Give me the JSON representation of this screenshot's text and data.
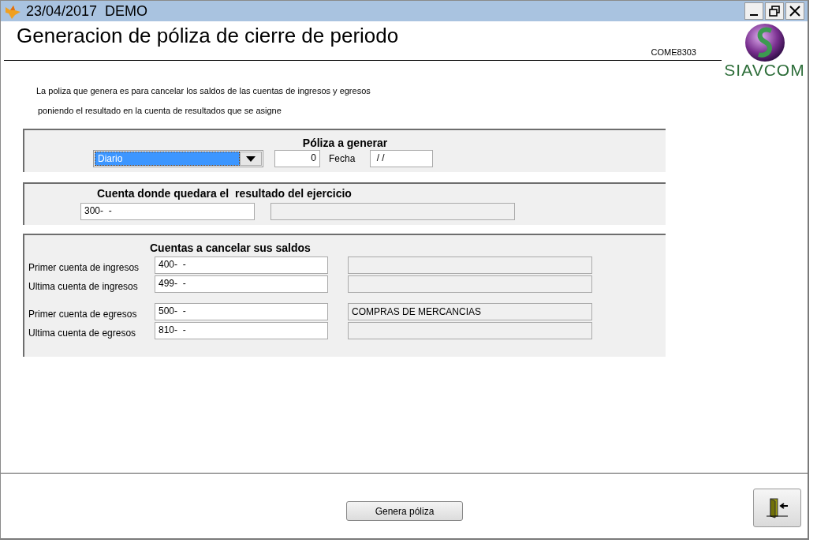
{
  "window": {
    "title": "23/04/2017  DEMO"
  },
  "header": {
    "title": "Generacion de póliza de cierre de periodo",
    "code": "COME8303",
    "logo_text": "SIAVCOM"
  },
  "description": [
    "La poliza que genera es para cancelar los saldos de las cuentas de ingresos y egresos",
    "poniendo el resultado en la cuenta de resultados que se asigne"
  ],
  "poliza_section": {
    "title": "Póliza a generar",
    "type_value": "Diario",
    "number": "0",
    "date_label": "Fecha",
    "date_value": " / /"
  },
  "result_section": {
    "title": "Cuenta donde quedara el  resultado del ejercicio",
    "account": "300-  -"
  },
  "cancel_section": {
    "title": "Cuentas a cancelar sus saldos",
    "groups": [
      {
        "rows": [
          {
            "label": "Primer cuenta de ingresos",
            "account": "400-  -"
          },
          {
            "label": "Ultima cuenta de ingresos",
            "account": "499-  -"
          }
        ]
      },
      {
        "rows": [
          {
            "label": "Primer cuenta de egresos",
            "account": "500-  -",
            "description": "COMPRAS DE MERCANCIAS"
          },
          {
            "label": "Ultima cuenta de egresos",
            "account": "810-  -"
          }
        ]
      }
    ]
  },
  "footer": {
    "generate_button": "Genera póliza"
  }
}
